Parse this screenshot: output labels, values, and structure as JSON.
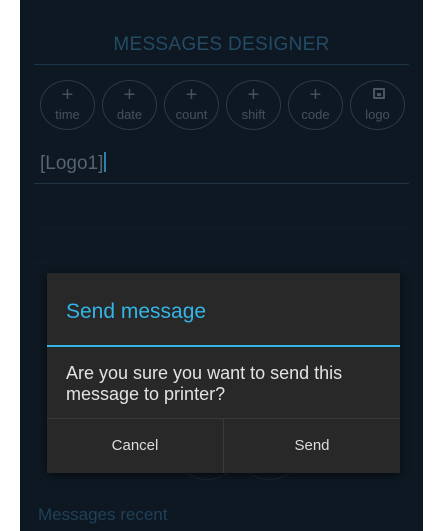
{
  "designer": {
    "title": "MESSAGES DESIGNER",
    "buttons": [
      {
        "glyph": "+",
        "label": "time"
      },
      {
        "glyph": "+",
        "label": "date"
      },
      {
        "glyph": "+",
        "label": "count"
      },
      {
        "glyph": "+",
        "label": "shift"
      },
      {
        "glyph": "+",
        "label": "code"
      },
      {
        "icon": "image-icon",
        "label": "logo"
      }
    ],
    "editor_value": "[Logo1]",
    "recent_heading": "Messages recent"
  },
  "dialog": {
    "title": "Send message",
    "message": "Are you sure you want to send this message to printer?",
    "cancel_label": "Cancel",
    "send_label": "Send",
    "accent_color": "#33b5e5"
  }
}
